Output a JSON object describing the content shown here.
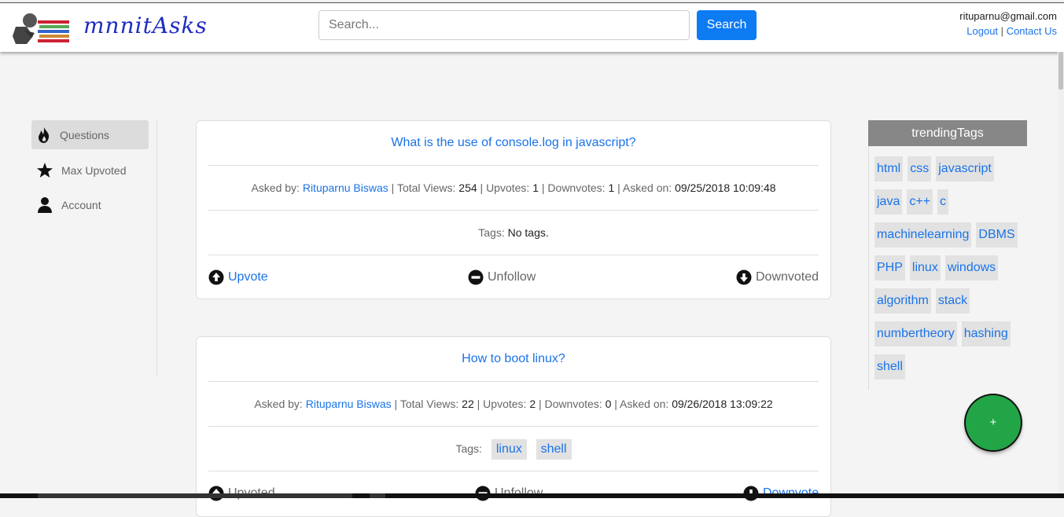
{
  "header": {
    "brand": "mnnitAsks",
    "search_placeholder": "Search...",
    "search_button": "Search",
    "user_email": "rituparnu@gmail.com",
    "logout": "Logout",
    "separator": "|",
    "contact": "Contact Us"
  },
  "sidebar": {
    "items": [
      {
        "label": "Questions",
        "icon": "fire-icon"
      },
      {
        "label": "Max Upvoted",
        "icon": "star-icon"
      },
      {
        "label": "Account",
        "icon": "user-icon"
      }
    ]
  },
  "labels": {
    "asked_by": "Asked by:",
    "total_views": "Total Views:",
    "upvotes": "Upvotes:",
    "downvotes": "Downvotes:",
    "asked_on": "Asked on:",
    "tags": "Tags:",
    "sep": "|"
  },
  "questions": [
    {
      "title": "What is the use of console.log in javascript?",
      "author": "Rituparnu Biswas",
      "views": "254",
      "upvotes": "1",
      "downvotes": "1",
      "date": "09/25/2018 10:09:48",
      "tags_text": "No tags.",
      "tags": [],
      "upvote_label": "Upvote",
      "follow_label": "Unfollow",
      "downvote_label": "Downvoted"
    },
    {
      "title": "How to boot linux?",
      "author": "Rituparnu Biswas",
      "views": "22",
      "upvotes": "2",
      "downvotes": "0",
      "date": "09/26/2018 13:09:22",
      "tags_text": "",
      "tags": [
        "linux",
        "shell"
      ],
      "upvote_label": "Upvoted",
      "follow_label": "Unfollow",
      "downvote_label": "Downvote"
    }
  ],
  "trending": {
    "title": "trendingTags",
    "tags": [
      "html",
      "css",
      "javascript",
      "java",
      "c++",
      "c",
      "machinelearning",
      "DBMS",
      "PHP",
      "linux",
      "windows",
      "algorithm",
      "stack",
      "numbertheory",
      "hashing",
      "shell"
    ]
  },
  "fab_label": "+",
  "colors": {
    "accent": "#0d7bf2",
    "link": "#1a73e8",
    "fab": "#22a546",
    "trend_header": "#878787"
  }
}
